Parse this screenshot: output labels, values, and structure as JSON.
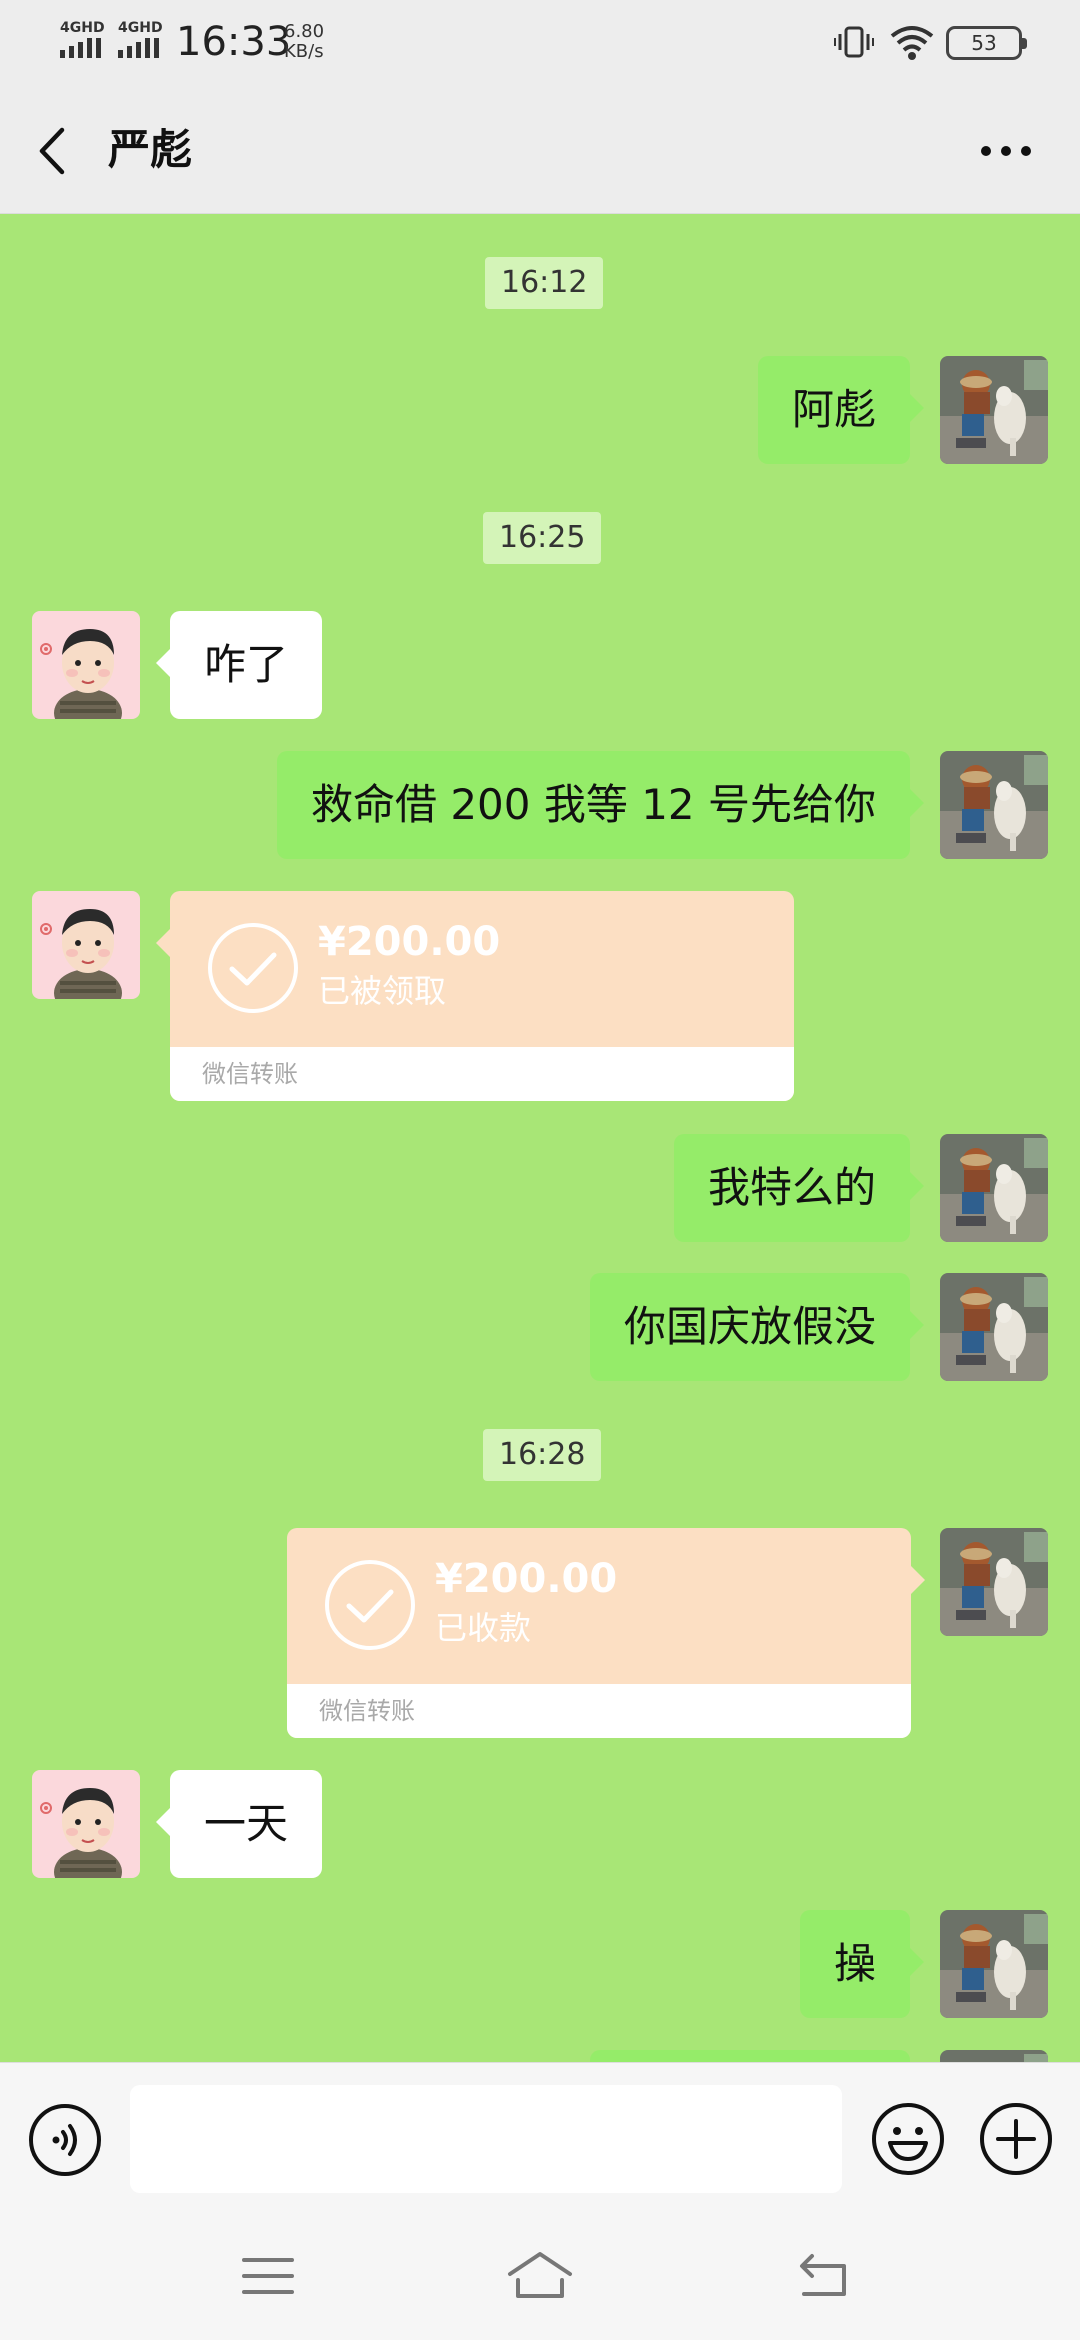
{
  "status_bar": {
    "signal1": "4GHD",
    "signal2": "4GHD",
    "time": "16:33",
    "speed_value": "6.80",
    "speed_unit": "KB/s",
    "battery": "53"
  },
  "header": {
    "back_icon": "chevron-left-icon",
    "title": "严彪",
    "more_icon": "more-dots-icon"
  },
  "messages": {
    "ts1": "16:12",
    "m1": "阿彪",
    "ts2": "16:25",
    "m2": "咋了",
    "m3": "救命借 200 我等 12 号先给你",
    "transfer1": {
      "amount": "¥200.00",
      "status": "已被领取",
      "footer": "微信转账"
    },
    "m4": "我特么的",
    "m5": "你国庆放假没",
    "ts3": "16:28",
    "transfer2": {
      "amount": "¥200.00",
      "status": "已收款",
      "footer": "微信转账"
    },
    "m6": "一天",
    "m7": "操"
  },
  "input_bar": {
    "voice_icon": "voice-icon",
    "input_value": "",
    "emoji_icon": "emoji-icon",
    "plus_icon": "plus-icon"
  },
  "nav_bar": {
    "menu_icon": "menu-icon",
    "home_icon": "home-icon",
    "back_icon": "back-icon"
  },
  "colors": {
    "chat_background": "#a8e676",
    "outgoing_bubble": "#95ec69",
    "incoming_bubble": "#ffffff",
    "transfer_card": "#fcdfc3"
  }
}
